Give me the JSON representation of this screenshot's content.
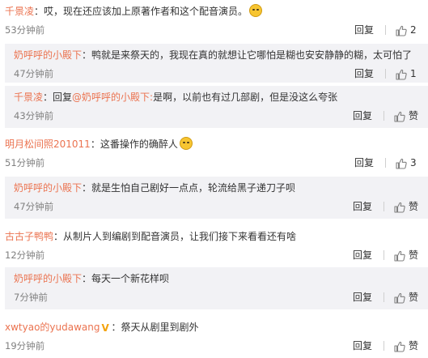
{
  "comments": [
    {
      "kind": "top",
      "user": "千景凌",
      "content": "哎，现在还应该加上原著作者和这个配音演员。",
      "emoji": true,
      "time": "53分钟前",
      "reply_label": "回复",
      "likes": "2"
    },
    {
      "kind": "reply",
      "user": "奶呼呼的小殿下",
      "content": "鸭就是来祭天的，我现在真的就想让它哪怕是糊也安安静静的糊，太可怕了",
      "time": "47分钟前",
      "reply_label": "回复",
      "likes": "1"
    },
    {
      "kind": "reply",
      "user": "千景凌",
      "prefix": "回复",
      "mention": "@奶呼呼的小殿下",
      "content": "是啊，以前也有过几部剧，但是没这么夸张",
      "time": "43分钟前",
      "reply_label": "回复",
      "likes": "赞"
    },
    {
      "kind": "top",
      "user": "明月松间照201011",
      "content": "这番操作的确醉人",
      "emoji": true,
      "time": "51分钟前",
      "reply_label": "回复",
      "likes": "3"
    },
    {
      "kind": "reply",
      "user": "奶呼呼的小殿下",
      "content": "就是生怕自己剧好一点点，轮流给黑子递刀子呗",
      "time": "47分钟前",
      "reply_label": "回复",
      "likes": "赞"
    },
    {
      "kind": "top",
      "user": "古古子鸭鸭",
      "content": "从制片人到编剧到配音演员，让我们接下来看看还有啥",
      "time": "12分钟前",
      "reply_label": "回复",
      "likes": "赞"
    },
    {
      "kind": "reply",
      "user": "奶呼呼的小殿下",
      "content": "每天一个新花样呗",
      "time": "7分钟前",
      "reply_label": "回复",
      "likes": "赞"
    },
    {
      "kind": "top",
      "user": "xwtyao的yudawang",
      "vip": true,
      "content": "祭天从剧里到剧外",
      "time": "19分钟前",
      "reply_label": "回复",
      "likes": "赞"
    }
  ],
  "colors": {
    "username": "#eb7350",
    "text": "#333333",
    "time": "#808080",
    "reply_bg": "#f2f2f5"
  }
}
